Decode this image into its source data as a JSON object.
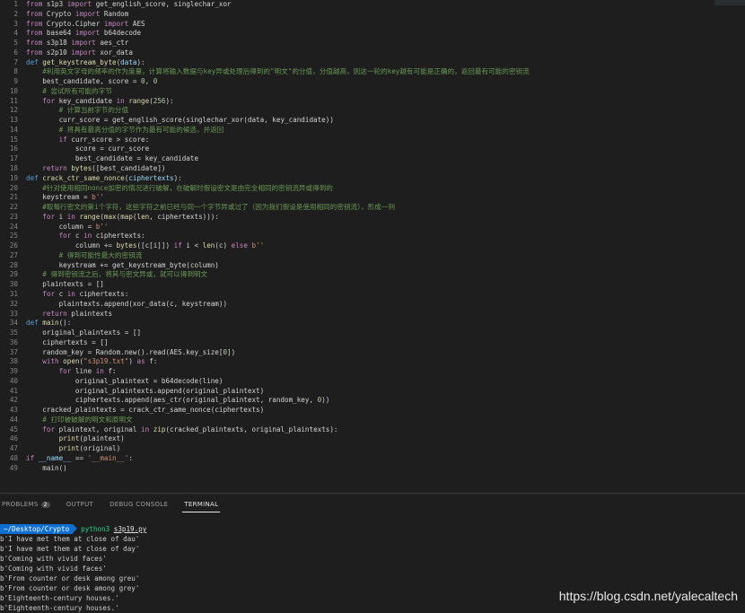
{
  "editor": {
    "lines": [
      [
        [
          "kw2",
          "from"
        ],
        [
          "t",
          " s1p3 "
        ],
        [
          "kw2",
          "import"
        ],
        [
          "t",
          " get_english_score, singlechar_xor"
        ]
      ],
      [
        [
          "kw2",
          "from"
        ],
        [
          "t",
          " Crypto "
        ],
        [
          "kw2",
          "import"
        ],
        [
          "t",
          " Random"
        ]
      ],
      [
        [
          "kw2",
          "from"
        ],
        [
          "t",
          " Crypto.Cipher "
        ],
        [
          "kw2",
          "import"
        ],
        [
          "t",
          " AES"
        ]
      ],
      [
        [
          "kw2",
          "from"
        ],
        [
          "t",
          " base64 "
        ],
        [
          "kw2",
          "import"
        ],
        [
          "t",
          " b64decode"
        ]
      ],
      [
        [
          "kw2",
          "from"
        ],
        [
          "t",
          " s3p18 "
        ],
        [
          "kw2",
          "import"
        ],
        [
          "t",
          " aes_ctr"
        ]
      ],
      [
        [
          "kw2",
          "from"
        ],
        [
          "t",
          " s2p10 "
        ],
        [
          "kw2",
          "import"
        ],
        [
          "t",
          " xor_data"
        ]
      ],
      [
        [
          "kw",
          "def"
        ],
        [
          "t",
          " "
        ],
        [
          "fn",
          "get_keystream_byte"
        ],
        [
          "t",
          "("
        ],
        [
          "id",
          "data"
        ],
        [
          "t",
          "):"
        ]
      ],
      [
        [
          "t",
          "    "
        ],
        [
          "cm",
          "#利用英文字母的频率的作为度量，计算将输入数据与key异或处理后得到的\"明文\"的分值，分值越高，则这一轮的key越有可能是正确的，返回最有可能的密钥流"
        ]
      ],
      [
        [
          "t",
          "    best_candidate, score = "
        ],
        [
          "nu",
          "0"
        ],
        [
          "t",
          ", "
        ],
        [
          "nu",
          "0"
        ]
      ],
      [
        [
          "t",
          "    "
        ],
        [
          "cm",
          "# 尝试所有可能的字节"
        ]
      ],
      [
        [
          "t",
          "    "
        ],
        [
          "kw2",
          "for"
        ],
        [
          "t",
          " key_candidate "
        ],
        [
          "kw2",
          "in"
        ],
        [
          "t",
          " "
        ],
        [
          "fn",
          "range"
        ],
        [
          "t",
          "("
        ],
        [
          "nu",
          "256"
        ],
        [
          "t",
          "):"
        ]
      ],
      [
        [
          "t",
          "        "
        ],
        [
          "cm",
          "# 计算当前字节的分值"
        ]
      ],
      [
        [
          "t",
          "        curr_score = get_english_score(singlechar_xor(data, key_candidate))"
        ]
      ],
      [
        [
          "t",
          "        "
        ],
        [
          "cm",
          "# 将具有最高分值的字节作为最有可能的候选，并返回"
        ]
      ],
      [
        [
          "t",
          "        "
        ],
        [
          "kw2",
          "if"
        ],
        [
          "t",
          " curr_score > score:"
        ]
      ],
      [
        [
          "t",
          "            score = curr_score"
        ]
      ],
      [
        [
          "t",
          "            best_candidate = key_candidate"
        ]
      ],
      [
        [
          "t",
          "    "
        ],
        [
          "kw2",
          "return"
        ],
        [
          "t",
          " "
        ],
        [
          "fn",
          "bytes"
        ],
        [
          "t",
          "([best_candidate])"
        ]
      ],
      [
        [
          "kw",
          "def"
        ],
        [
          "t",
          " "
        ],
        [
          "fn",
          "crack_ctr_same_nonce"
        ],
        [
          "t",
          "("
        ],
        [
          "id",
          "ciphertexts"
        ],
        [
          "t",
          "):"
        ]
      ],
      [
        [
          "t",
          "    "
        ],
        [
          "cm",
          "#针对使用相同nonce加密的情况进行破解，在破解时假设密文是由完全相同的密钥流异或得到的"
        ]
      ],
      [
        [
          "t",
          "    keystream = "
        ],
        [
          "st",
          "b''"
        ]
      ],
      [
        [
          "t",
          "    "
        ],
        [
          "cm",
          "#取每行密文的第i个字符，这些字符之前已经与同一个字节异或过了（因为我们假设是使用相同的密钥流），形成一列"
        ]
      ],
      [
        [
          "t",
          "    "
        ],
        [
          "kw2",
          "for"
        ],
        [
          "t",
          " i "
        ],
        [
          "kw2",
          "in"
        ],
        [
          "t",
          " "
        ],
        [
          "fn",
          "range"
        ],
        [
          "t",
          "("
        ],
        [
          "fn",
          "max"
        ],
        [
          "t",
          "("
        ],
        [
          "fn",
          "map"
        ],
        [
          "t",
          "("
        ],
        [
          "fn",
          "len"
        ],
        [
          "t",
          ", ciphertexts))):"
        ]
      ],
      [
        [
          "t",
          "        column = "
        ],
        [
          "st",
          "b''"
        ]
      ],
      [
        [
          "t",
          "        "
        ],
        [
          "kw2",
          "for"
        ],
        [
          "t",
          " c "
        ],
        [
          "kw2",
          "in"
        ],
        [
          "t",
          " ciphertexts:"
        ]
      ],
      [
        [
          "t",
          "            column += "
        ],
        [
          "fn",
          "bytes"
        ],
        [
          "t",
          "([c[i]]) "
        ],
        [
          "kw2",
          "if"
        ],
        [
          "t",
          " i < "
        ],
        [
          "fn",
          "len"
        ],
        [
          "t",
          "(c) "
        ],
        [
          "kw2",
          "else"
        ],
        [
          "t",
          " "
        ],
        [
          "st",
          "b''"
        ]
      ],
      [
        [
          "t",
          "        "
        ],
        [
          "cm",
          "# 得到可能性最大的密钥流"
        ]
      ],
      [
        [
          "t",
          "        keystream += get_keystream_byte(column)"
        ]
      ],
      [
        [
          "t",
          "    "
        ],
        [
          "cm",
          "# 得到密钥流之后，将其与密文异或，就可以得到明文"
        ]
      ],
      [
        [
          "t",
          "    plaintexts = []"
        ]
      ],
      [
        [
          "t",
          "    "
        ],
        [
          "kw2",
          "for"
        ],
        [
          "t",
          " c "
        ],
        [
          "kw2",
          "in"
        ],
        [
          "t",
          " ciphertexts:"
        ]
      ],
      [
        [
          "t",
          "        plaintexts.append(xor_data(c, keystream))"
        ]
      ],
      [
        [
          "t",
          "    "
        ],
        [
          "kw2",
          "return"
        ],
        [
          "t",
          " plaintexts"
        ]
      ],
      [
        [
          "kw",
          "def"
        ],
        [
          "t",
          " "
        ],
        [
          "fn",
          "main"
        ],
        [
          "t",
          "():"
        ]
      ],
      [
        [
          "t",
          "    original_plaintexts = []"
        ]
      ],
      [
        [
          "t",
          "    ciphertexts = []"
        ]
      ],
      [
        [
          "t",
          "    random_key = Random.new().read(AES.key_size["
        ],
        [
          "nu",
          "0"
        ],
        [
          "t",
          "])"
        ]
      ],
      [
        [
          "t",
          "    "
        ],
        [
          "kw2",
          "with"
        ],
        [
          "t",
          " "
        ],
        [
          "fn",
          "open"
        ],
        [
          "t",
          "("
        ],
        [
          "st",
          "\"s3p19.txt\""
        ],
        [
          "t",
          ") "
        ],
        [
          "kw2",
          "as"
        ],
        [
          "t",
          " f:"
        ]
      ],
      [
        [
          "t",
          "        "
        ],
        [
          "kw2",
          "for"
        ],
        [
          "t",
          " line "
        ],
        [
          "kw2",
          "in"
        ],
        [
          "t",
          " f:"
        ]
      ],
      [
        [
          "t",
          "            original_plaintext = b64decode(line)"
        ]
      ],
      [
        [
          "t",
          "            original_plaintexts.append(original_plaintext)"
        ]
      ],
      [
        [
          "t",
          "            ciphertexts.append(aes_ctr(original_plaintext, random_key, "
        ],
        [
          "nu",
          "0"
        ],
        [
          "t",
          "))"
        ]
      ],
      [
        [
          "t",
          "    cracked_plaintexts = crack_ctr_same_nonce(ciphertexts)"
        ]
      ],
      [
        [
          "t",
          "    "
        ],
        [
          "cm",
          "# 打印被破解的明文和原明文"
        ]
      ],
      [
        [
          "t",
          "    "
        ],
        [
          "kw2",
          "for"
        ],
        [
          "t",
          " plaintext, original "
        ],
        [
          "kw2",
          "in"
        ],
        [
          "t",
          " "
        ],
        [
          "fn",
          "zip"
        ],
        [
          "t",
          "(cracked_plaintexts, original_plaintexts):"
        ]
      ],
      [
        [
          "t",
          "        "
        ],
        [
          "fn",
          "print"
        ],
        [
          "t",
          "(plaintext)"
        ]
      ],
      [
        [
          "t",
          "        "
        ],
        [
          "fn",
          "print"
        ],
        [
          "t",
          "(original)"
        ]
      ],
      [
        [
          "kw2",
          "if"
        ],
        [
          "t",
          " "
        ],
        [
          "id",
          "__name__"
        ],
        [
          "t",
          " == "
        ],
        [
          "st",
          "'__main__'"
        ],
        [
          "t",
          ":"
        ]
      ],
      [
        [
          "t",
          "    main()"
        ]
      ]
    ]
  },
  "panel": {
    "tabs": [
      {
        "label": "PROBLEMS",
        "badge": "2",
        "active": false
      },
      {
        "label": "OUTPUT",
        "badge": null,
        "active": false
      },
      {
        "label": "DEBUG CONSOLE",
        "badge": null,
        "active": false
      },
      {
        "label": "TERMINAL",
        "badge": null,
        "active": true
      }
    ],
    "terminal": {
      "prompt_path": "~/Desktop/Crypto",
      "command": "python3",
      "argument": "s3p19.py",
      "output": [
        "b'I have met them at close of dau'",
        "b'I have met them at close of day'",
        "b'Coming with vivid faces'",
        "b'Coming with vivid faces'",
        "b'From counter or desk among greu'",
        "b'From counter or desk among grey'",
        "b'Eighteenth-century houses.'",
        "b'Eighteenth-century houses.'"
      ]
    }
  },
  "watermark": "https://blog.csdn.net/yalecaltech"
}
